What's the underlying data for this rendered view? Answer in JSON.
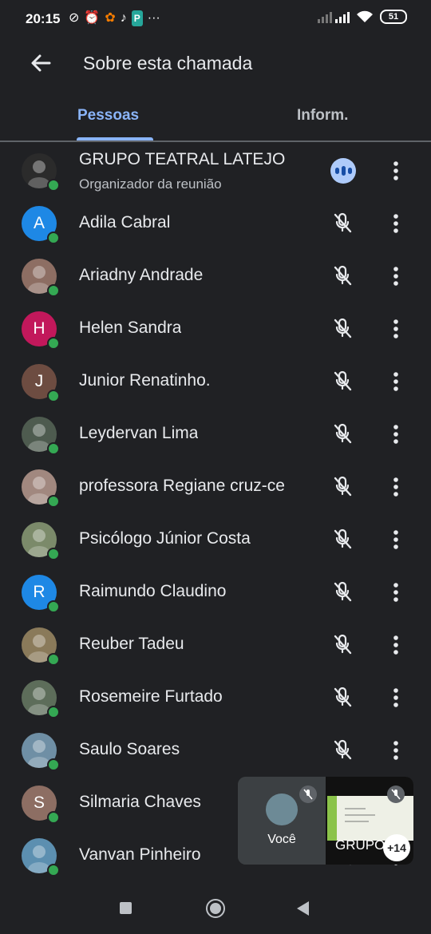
{
  "status": {
    "time": "20:15",
    "battery": "51"
  },
  "header": {
    "title": "Sobre esta chamada"
  },
  "tabs": [
    {
      "label": "Pessoas"
    },
    {
      "label": "Inform."
    }
  ],
  "participants": [
    {
      "name": "GRUPO TEATRAL LATEJO",
      "subtitle": "Organizador da reunião",
      "avatar_type": "photo",
      "avatar_color": "#2b2b2b",
      "mic": "speaking"
    },
    {
      "name": "Adila Cabral",
      "avatar_type": "letter",
      "initial": "A",
      "avatar_color": "#1e88e5",
      "mic": "muted"
    },
    {
      "name": "Ariadny Andrade",
      "avatar_type": "photo",
      "avatar_color": "#8d6e63",
      "mic": "muted"
    },
    {
      "name": "Helen Sandra",
      "avatar_type": "letter",
      "initial": "H",
      "avatar_color": "#c2185b",
      "mic": "muted"
    },
    {
      "name": "Junior Renatinho.",
      "avatar_type": "letter",
      "initial": "J",
      "avatar_color": "#6d4c41",
      "mic": "muted"
    },
    {
      "name": "Leydervan Lima",
      "avatar_type": "photo",
      "avatar_color": "#4e5b4f",
      "mic": "muted"
    },
    {
      "name": "professora Regiane cruz-ce",
      "avatar_type": "photo",
      "avatar_color": "#a1887f",
      "mic": "muted"
    },
    {
      "name": "Psicólogo Júnior Costa",
      "avatar_type": "photo",
      "avatar_color": "#7b8a6a",
      "mic": "muted"
    },
    {
      "name": "Raimundo Claudino",
      "avatar_type": "letter",
      "initial": "R",
      "avatar_color": "#1e88e5",
      "mic": "muted"
    },
    {
      "name": "Reuber Tadeu",
      "avatar_type": "photo",
      "avatar_color": "#8a7a5a",
      "mic": "muted"
    },
    {
      "name": "Rosemeire Furtado",
      "avatar_type": "photo",
      "avatar_color": "#5d6d5a",
      "mic": "muted"
    },
    {
      "name": "Saulo Soares",
      "avatar_type": "photo",
      "avatar_color": "#6f8fa5",
      "mic": "muted"
    },
    {
      "name": "Silmaria Chaves",
      "avatar_type": "letter",
      "initial": "S",
      "avatar_color": "#8d6e63",
      "mic": "muted"
    },
    {
      "name": "Vanvan Pinheiro",
      "avatar_type": "photo",
      "avatar_color": "#5c8fb0",
      "mic": "muted"
    }
  ],
  "pip": {
    "self_label": "Você",
    "other_label": "GRUPO",
    "overflow_count": "+14"
  },
  "colors": {
    "background": "#202124",
    "accent": "#8ab4f8",
    "presence": "#34a853"
  }
}
